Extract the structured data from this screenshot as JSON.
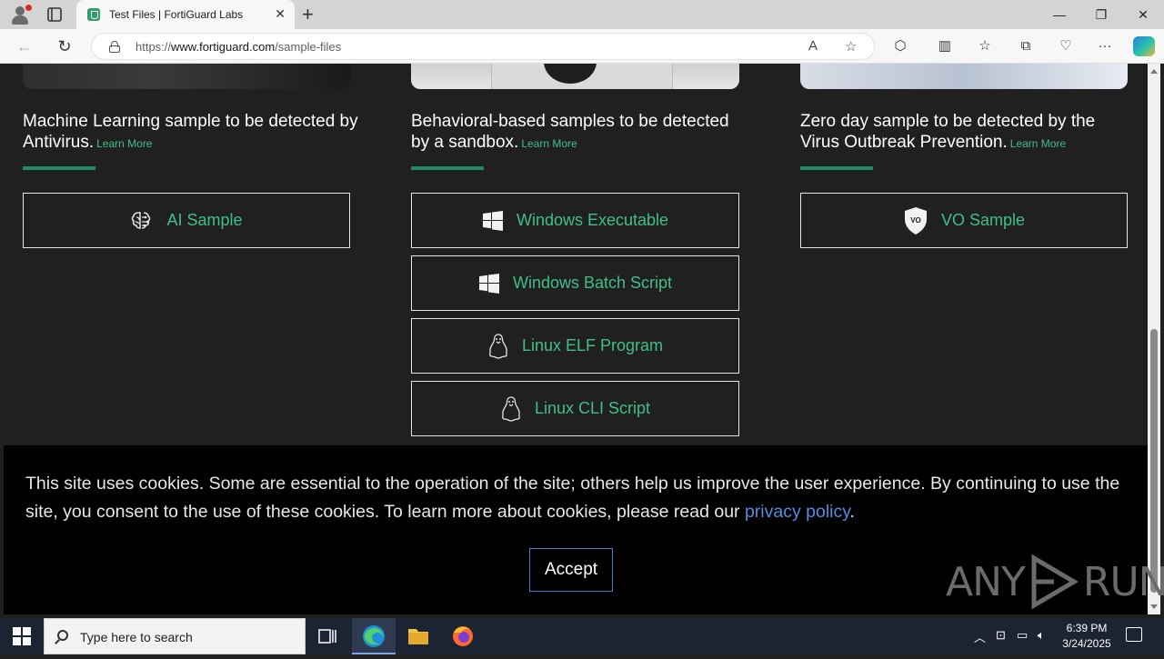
{
  "browser": {
    "tab_title": "Test Files | FortiGuard Labs",
    "url_prefix": "https://",
    "url_host": "www.fortiguard.com",
    "url_path": "/sample-files"
  },
  "columns": [
    {
      "heading": "Machine Learning sample to be detected by Antivirus.",
      "learn_more": "Learn More",
      "buttons": [
        {
          "label": "AI Sample",
          "icon": "brain-icon"
        }
      ]
    },
    {
      "heading": "Behavioral-based samples to be detected by a sandbox.",
      "learn_more": "Learn More",
      "buttons": [
        {
          "label": "Windows Executable",
          "icon": "windows-icon"
        },
        {
          "label": "Windows Batch Script",
          "icon": "windows-icon"
        },
        {
          "label": "Linux ELF Program",
          "icon": "linux-icon"
        },
        {
          "label": "Linux CLI Script",
          "icon": "linux-icon"
        }
      ]
    },
    {
      "heading": "Zero day sample to be detected by the Virus Outbreak Prevention.",
      "learn_more": "Learn More",
      "buttons": [
        {
          "label": "VO Sample",
          "icon": "vo-shield-icon",
          "icon_text": "VO"
        }
      ]
    }
  ],
  "cookie_banner": {
    "text": "This site uses cookies. Some are essential to the operation of the site; others help us improve the user experience. By continuing to use the site, you consent to the use of these cookies. To learn more about cookies, please read our ",
    "link": "privacy policy",
    "after": ".",
    "accept": "Accept"
  },
  "watermark": {
    "left": "ANY",
    "right": "RUN"
  },
  "taskbar": {
    "search_placeholder": "Type here to search",
    "time": "6:39 PM",
    "date": "3/24/2025"
  },
  "colors": {
    "accent_green": "#3fbf8a",
    "rule_green": "#1f8c60",
    "link_blue": "#4f8fe0",
    "page_bg": "#202020"
  }
}
